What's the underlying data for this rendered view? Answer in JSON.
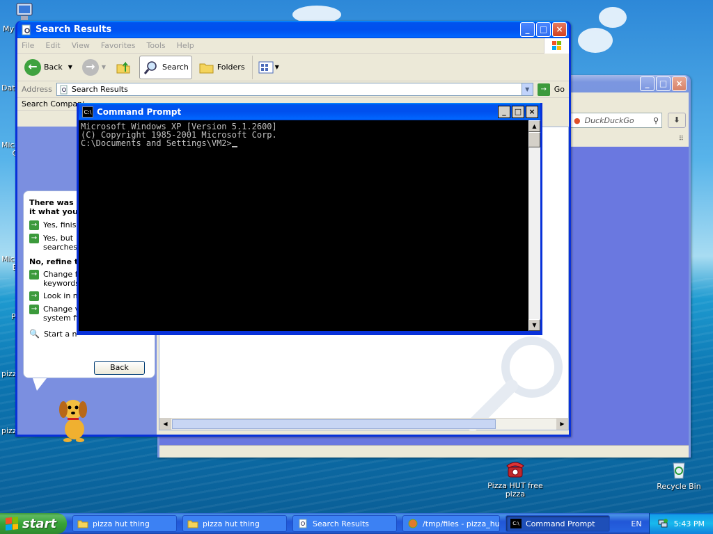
{
  "desktop": {
    "left_icons": [
      {
        "label": "My"
      },
      {
        "label": "Dat"
      },
      {
        "label": "Micr"
      },
      {
        "label": "C"
      },
      {
        "label": "Micr"
      },
      {
        "label": "B"
      },
      {
        "label": "P"
      },
      {
        "label": "pizz"
      },
      {
        "label": "pizz"
      }
    ],
    "pizza_icon": {
      "line1": "Pizza HUT free",
      "line2": "pizza"
    },
    "recycle_bin": {
      "label": "Recycle Bin"
    }
  },
  "search_window": {
    "title": "Search Results",
    "menu": [
      "File",
      "Edit",
      "View",
      "Favorites",
      "Tools",
      "Help"
    ],
    "toolbar": {
      "back": "Back",
      "search": "Search",
      "folders": "Folders"
    },
    "address_label": "Address",
    "address_value": "Search Results",
    "go": "Go",
    "pane_header": "Search Compani",
    "companion": {
      "title_line1": "There was c",
      "title_line2": "it what you",
      "items": [
        {
          "line1": "Yes, finis",
          "line2": ""
        },
        {
          "line1": "Yes, but",
          "line2": "searches"
        }
      ],
      "refine_heading": "No, refine th",
      "refine_items": [
        {
          "line1": "Change f",
          "line2": "keywords"
        },
        {
          "line1": "Look in m",
          "line2": ""
        },
        {
          "line1": "Change v",
          "line2": "system fi"
        }
      ],
      "start_new": "Start a n",
      "back_button": "Back"
    }
  },
  "browser_window": {
    "search_placeholder": "DuckDuckGo"
  },
  "cmd_window": {
    "title": "Command Prompt",
    "icon_text": "C:\\",
    "lines": [
      "Microsoft Windows XP [Version 5.1.2600]",
      "(C) Copyright 1985-2001 Microsoft Corp.",
      "",
      "C:\\Documents and Settings\\VM2>"
    ]
  },
  "taskbar": {
    "start": "start",
    "tasks": [
      {
        "label": "pizza hut thing"
      },
      {
        "label": "pizza hut thing"
      },
      {
        "label": "Search Results"
      },
      {
        "label": "/tmp/files - pizza_hut..."
      },
      {
        "label": "Command Prompt"
      }
    ],
    "language": "EN",
    "clock": "5:43 PM"
  },
  "colors": {
    "title_active": "#0054e3",
    "title_inactive": "#7a96df",
    "console_bg": "#000000",
    "console_fg": "#c0c0c0",
    "start_green": "#3c9a3c"
  }
}
